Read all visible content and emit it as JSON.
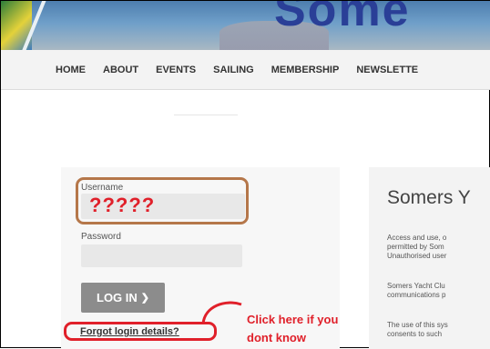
{
  "nav": {
    "items": [
      "HOME",
      "ABOUT",
      "EVENTS",
      "SAILING",
      "MEMBERSHIP",
      "NEWSLETTE"
    ]
  },
  "login": {
    "username_label": "Username",
    "username_value": "?????",
    "password_label": "Password",
    "button_label": "LOG IN",
    "button_arrow": "❯",
    "forgot_link": "Forgot login details?"
  },
  "annotation": {
    "line1": "Click here if you",
    "line2": "dont know"
  },
  "info": {
    "title": "Somers Y",
    "para1": [
      "Access and use, o",
      "permitted by Som",
      "Unauthorised user"
    ],
    "para2": [
      "Somers Yacht Clu",
      "communications p"
    ],
    "para3": [
      "The use of this sys",
      "consents to such"
    ]
  },
  "colors": {
    "annotation_red": "#e0202a",
    "highlight_brown": "#b5774a",
    "button_gray": "#8c8c8c"
  }
}
